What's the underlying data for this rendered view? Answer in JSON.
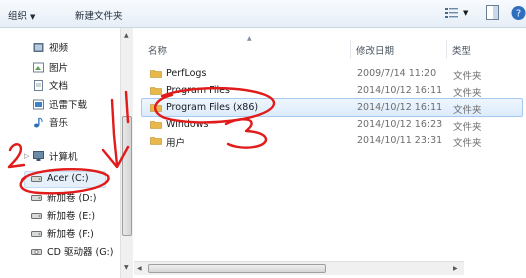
{
  "toolbar": {
    "organize": "组织",
    "new_folder": "新建文件夹"
  },
  "nav": {
    "libraries": [
      "视频",
      "图片",
      "文档",
      "迅雷下载",
      "音乐"
    ],
    "computer": "计算机",
    "drives": [
      "Acer (C:)",
      "新加卷 (D:)",
      "新加卷 (E:)",
      "新加卷 (F:)",
      "CD 驱动器 (G:)"
    ]
  },
  "columns": {
    "name": "名称",
    "modified": "修改日期",
    "type": "类型"
  },
  "files": [
    {
      "name": "PerfLogs",
      "date": "2009/7/14 11:20",
      "type": "文件夹"
    },
    {
      "name": "Program Files",
      "date": "2014/10/12 16:11",
      "type": "文件夹"
    },
    {
      "name": "Program Files (x86)",
      "date": "2014/10/12 16:11",
      "type": "文件夹"
    },
    {
      "name": "Windows",
      "date": "2014/10/12 16:23",
      "type": "文件夹"
    },
    {
      "name": "用户",
      "date": "2014/10/11 23:31",
      "type": "文件夹"
    }
  ],
  "annotations": {
    "mark_1": "1",
    "mark_2": "2",
    "mark_3": "3"
  },
  "colors": {
    "accent": "#3a6ea5",
    "annotation": "#e11a1a",
    "selection": "#dcebfc",
    "folder": "#e8b94a"
  }
}
